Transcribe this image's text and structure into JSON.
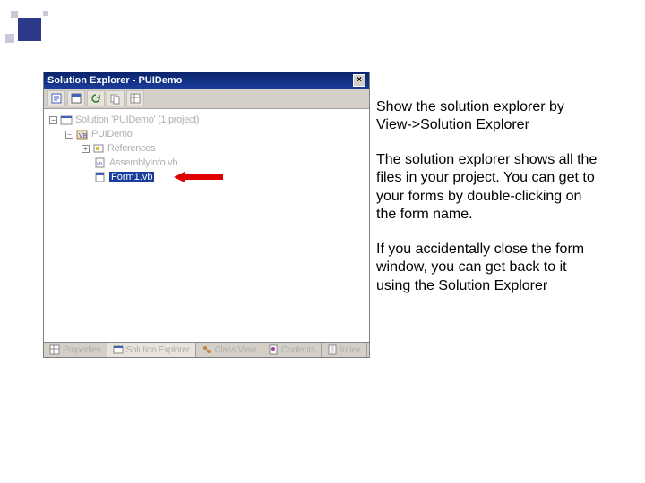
{
  "decor": {},
  "solution_explorer": {
    "title": "Solution Explorer - PUIDemo",
    "close_glyph": "×",
    "toolbar_buttons": [
      {
        "name": "view-code-icon"
      },
      {
        "name": "view-designer-icon"
      },
      {
        "name": "refresh-icon"
      },
      {
        "name": "show-all-icon"
      },
      {
        "name": "properties-icon"
      }
    ],
    "tree": {
      "solution": {
        "label": "Solution 'PUIDemo' (1 project)",
        "expander": "−"
      },
      "project": {
        "label": "PUIDemo",
        "expander": "−"
      },
      "refs": {
        "label": "References",
        "expander": "+"
      },
      "assembly": {
        "label": "AssemblyInfo.vb"
      },
      "form": {
        "label": "Form1.vb"
      }
    },
    "tabs": [
      {
        "label": "Properties",
        "icon": "properties-icon"
      },
      {
        "label": "Solution Explorer",
        "icon": "solution-explorer-icon",
        "active": true
      },
      {
        "label": "Class View",
        "icon": "class-view-icon"
      },
      {
        "label": "Contents",
        "icon": "contents-icon"
      },
      {
        "label": "Index",
        "icon": "index-icon"
      }
    ]
  },
  "instructions": {
    "p1": "Show the solution explorer by View->Solution Explorer",
    "p2": "The solution explorer shows all the files in your project. You can get to your forms by double-clicking on the form name.",
    "p3": "If you accidentally close the form window, you can get back to it using the Solution Explorer"
  }
}
